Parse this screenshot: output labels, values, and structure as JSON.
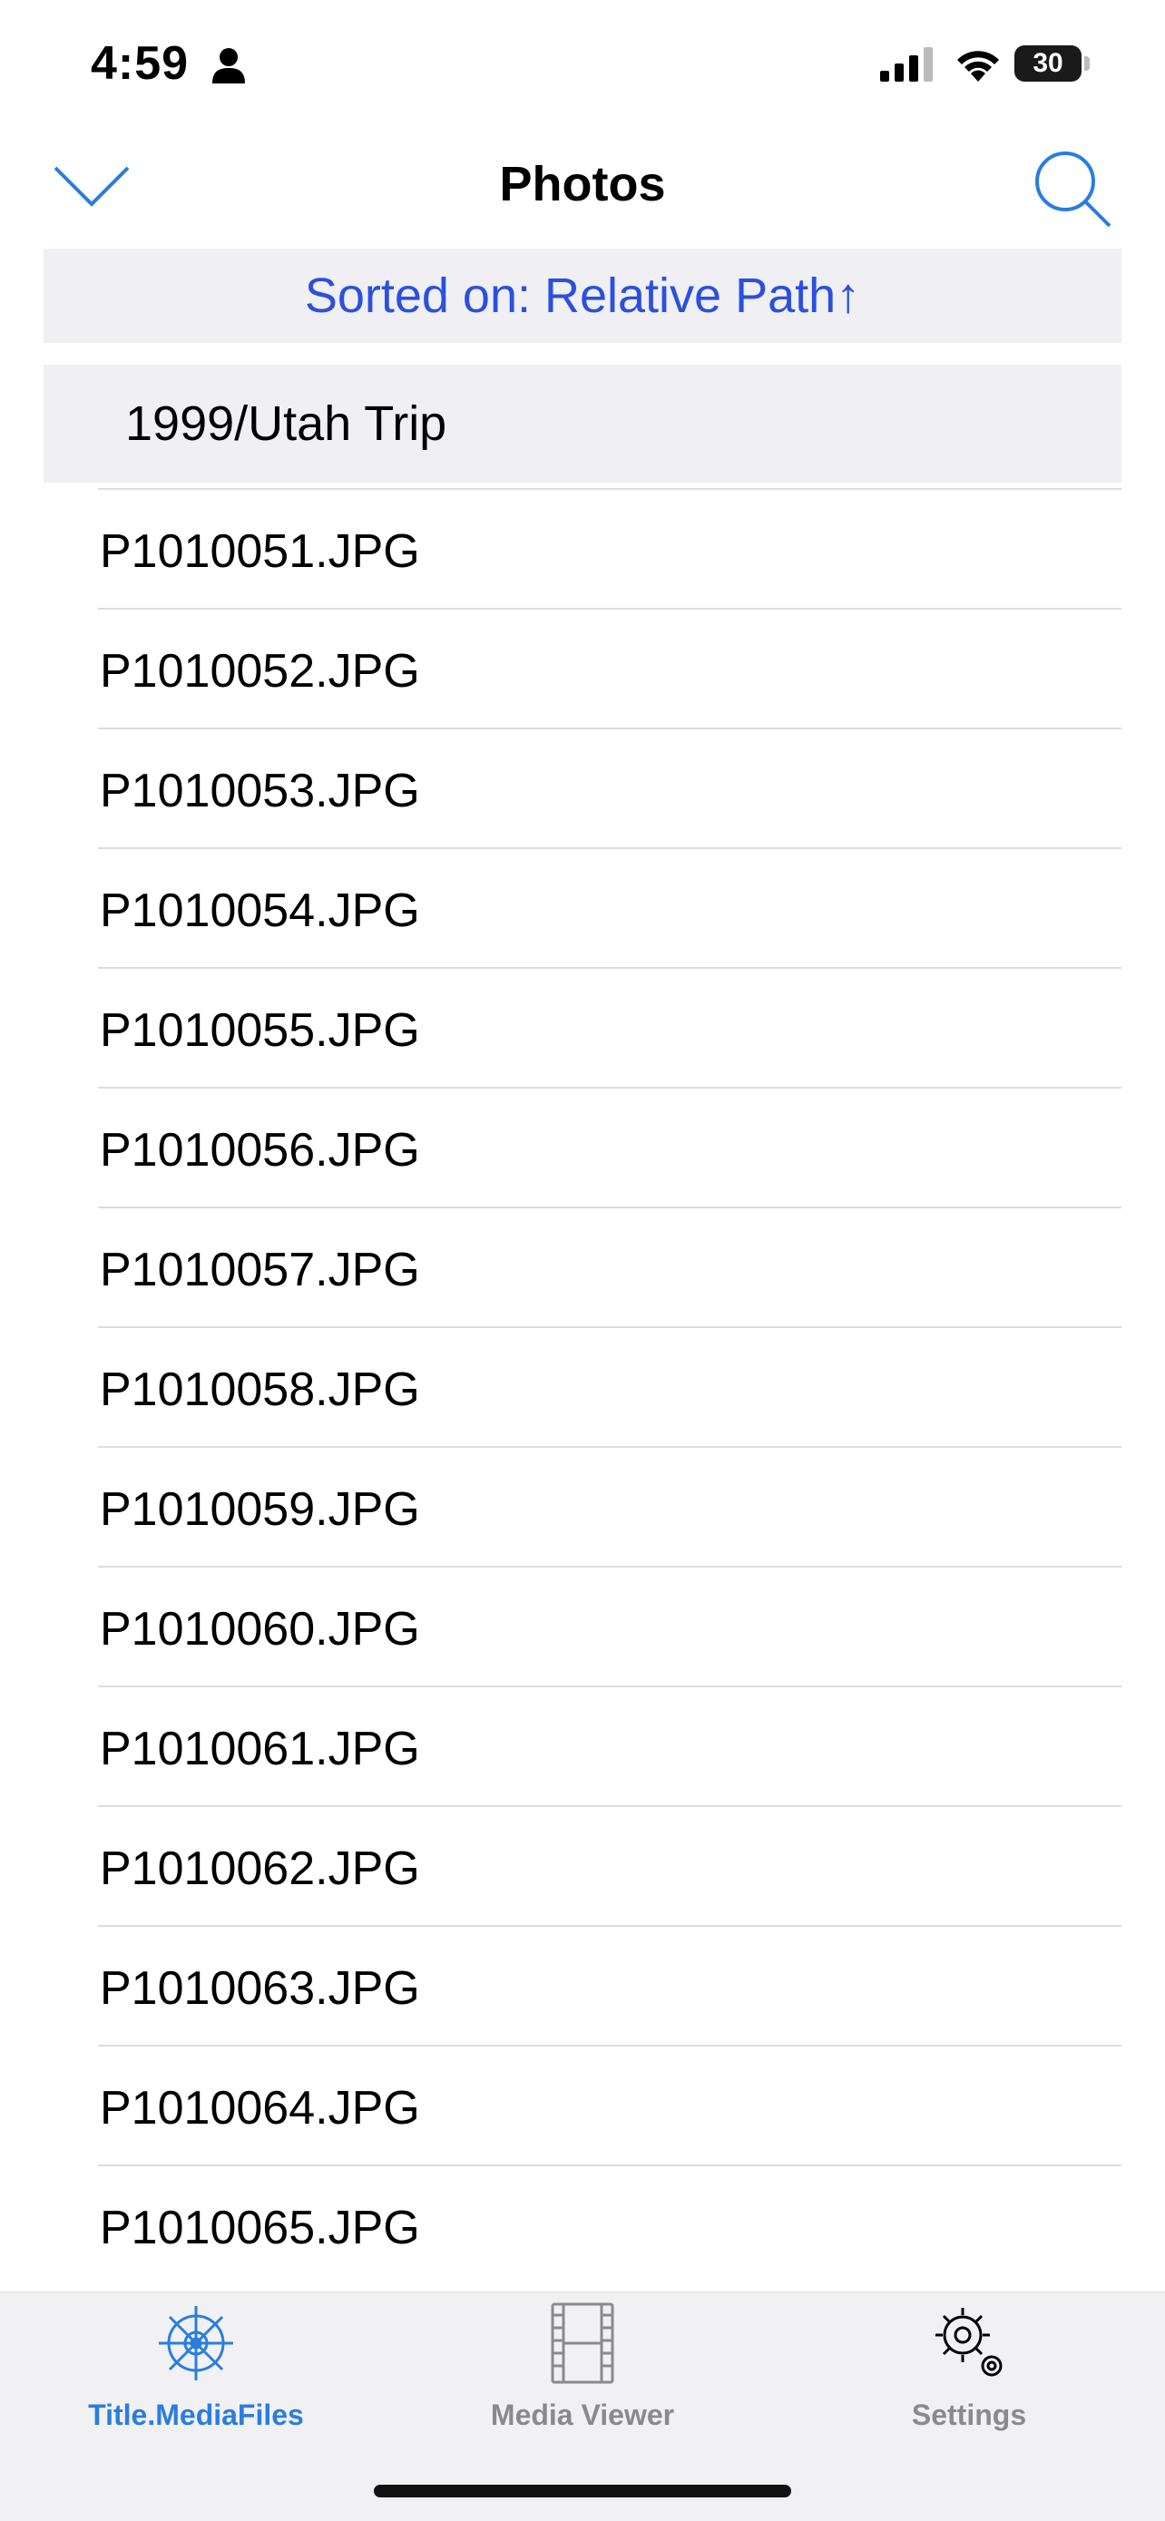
{
  "status_bar": {
    "time": "4:59",
    "battery": "30"
  },
  "nav": {
    "title": "Photos",
    "back_icon": "chevron-down-icon",
    "search_icon": "search-icon"
  },
  "sort_bar": {
    "label": "Sorted on: Relative Path↑"
  },
  "section": {
    "title": "1999/Utah Trip"
  },
  "rows": [
    "P1010051.JPG",
    "P1010052.JPG",
    "P1010053.JPG",
    "P1010054.JPG",
    "P1010055.JPG",
    "P1010056.JPG",
    "P1010057.JPG",
    "P1010058.JPG",
    "P1010059.JPG",
    "P1010060.JPG",
    "P1010061.JPG",
    "P1010062.JPG",
    "P1010063.JPG",
    "P1010064.JPG",
    "P1010065.JPG"
  ],
  "tabs": [
    {
      "label": "Title.MediaFiles",
      "icon": "ship-wheel-icon",
      "active": true
    },
    {
      "label": "Media Viewer",
      "icon": "film-strip-icon",
      "active": false
    },
    {
      "label": "Settings",
      "icon": "gears-icon",
      "active": false
    }
  ],
  "colors": {
    "accent": "#2b4fe0",
    "tab_active": "#2a7de1",
    "tab_inactive": "#8a8a8e",
    "section_bg": "#efeff4"
  }
}
